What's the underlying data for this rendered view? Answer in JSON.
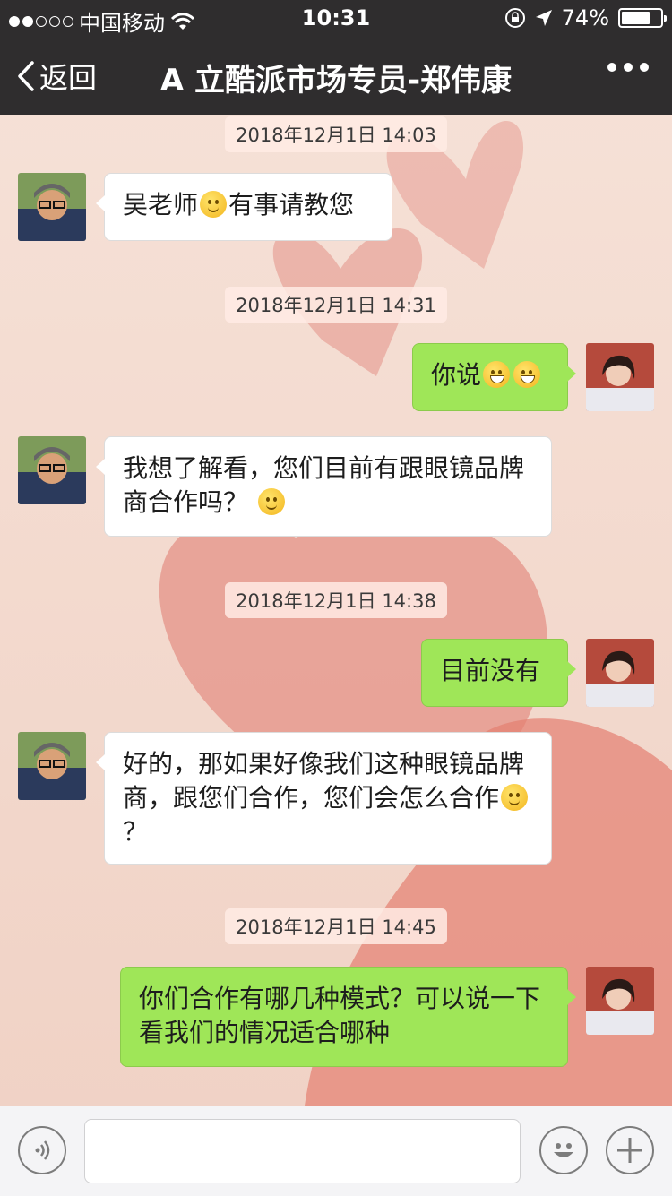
{
  "status_bar": {
    "carrier": "中国移动",
    "time": "10:31",
    "battery": "74%",
    "battery_level": 0.74
  },
  "nav": {
    "back_label": "返回",
    "title": "A 立酷派市场专员-郑伟康"
  },
  "messages": {
    "stamps": [
      "2018年12月1日 14:03",
      "2018年12月1日 14:31",
      "2018年12月1日 14:38",
      "2018年12月1日 14:45"
    ],
    "m1": "吴老师",
    "m1b": "有事请教您",
    "m2": "你说",
    "m3": "我想了解看，您们目前有跟眼镜品牌商合作吗？",
    "m4": "目前没有",
    "m5a": "好的，那如果好像我们这种眼镜品牌商，跟您们合作，您们会怎么合作",
    "m5b": "？",
    "m6": "你们合作有哪几种模式？可以说一下 看我们的情况适合哪种"
  },
  "input": {
    "value": ""
  },
  "colors": {
    "nav_bg": "#2f2d2e",
    "out_bubble": "#9fe658",
    "in_bubble": "#ffffff"
  },
  "icons": [
    "back-chevron-icon",
    "more-icon",
    "voice-icon",
    "emoji-icon",
    "plus-icon",
    "wifi-icon",
    "location-icon",
    "lock-rotation-icon"
  ]
}
